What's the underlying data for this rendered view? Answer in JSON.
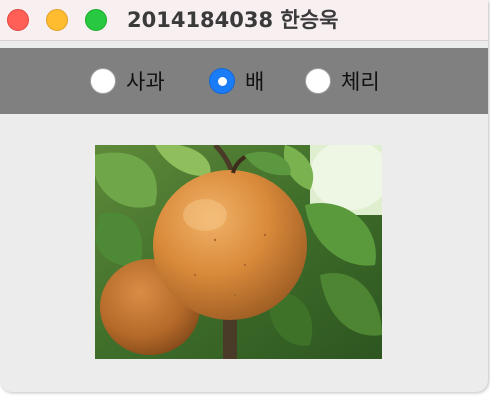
{
  "window": {
    "title": "2014184038 한승욱",
    "controls": [
      "close-button",
      "minimize-button",
      "maximize-button"
    ]
  },
  "fruit_options": [
    {
      "label": "사과",
      "selected": false
    },
    {
      "label": "배",
      "selected": true
    },
    {
      "label": "체리",
      "selected": false
    }
  ],
  "image": {
    "subject": "pear",
    "icon": "pear-photo"
  },
  "colors": {
    "titlebar": "#f7eff0",
    "radiobar": "#808080",
    "content": "#ececec",
    "accent": "#1a7cf6",
    "close": "#ff5f57",
    "minimize": "#febc2e",
    "maximize": "#28c840"
  }
}
